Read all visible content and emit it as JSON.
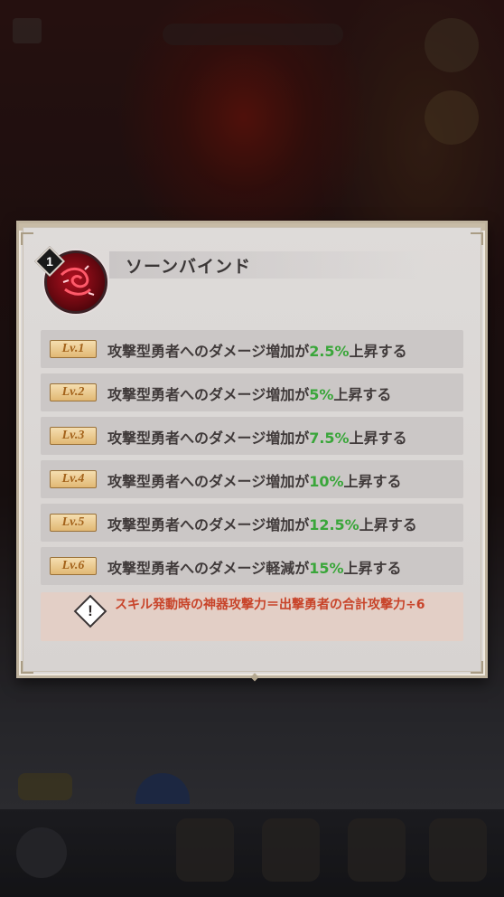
{
  "skill": {
    "level_number": "1",
    "name": "ソーンバインド"
  },
  "levels": [
    {
      "badge": "Lv.1",
      "prefix": "攻撃型勇者へのダメージ増加が",
      "value": "2.5%",
      "suffix": "上昇する"
    },
    {
      "badge": "Lv.2",
      "prefix": "攻撃型勇者へのダメージ増加が",
      "value": "5%",
      "suffix": "上昇する"
    },
    {
      "badge": "Lv.3",
      "prefix": "攻撃型勇者へのダメージ増加が",
      "value": "7.5%",
      "suffix": "上昇する"
    },
    {
      "badge": "Lv.4",
      "prefix": "攻撃型勇者へのダメージ増加が",
      "value": "10%",
      "suffix": "上昇する"
    },
    {
      "badge": "Lv.5",
      "prefix": "攻撃型勇者へのダメージ増加が",
      "value": "12.5%",
      "suffix": "上昇する"
    },
    {
      "badge": "Lv.6",
      "prefix": "攻撃型勇者へのダメージ軽減が",
      "value": "15%",
      "suffix": "上昇する"
    }
  ],
  "note": {
    "text": "スキル発動時の神器攻撃力＝出撃勇者の合計攻撃力÷6",
    "icon": "warning-icon"
  },
  "colors": {
    "highlight": "#3aa63a",
    "note_text": "#c8442a",
    "badge_text": "#a3621a"
  }
}
